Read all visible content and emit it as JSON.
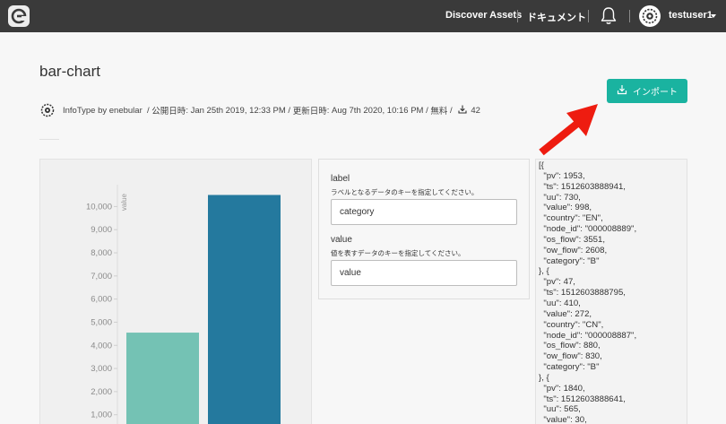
{
  "nav": {
    "discover_label": "Discover Assets",
    "docs_label": "ドキュメント",
    "username": "testuser1"
  },
  "asset": {
    "title": "bar-chart",
    "import_label": "インポート",
    "author": "InfoType by enebular",
    "published_label": "公開日時",
    "published_value": "Jan 25th 2019, 12:33 PM",
    "updated_label": "更新日時",
    "updated_value": "Aug 7th 2020, 10:16 PM",
    "price": "無料",
    "downloads": "42"
  },
  "form": {
    "label_field": {
      "label": "label",
      "help": "ラベルとなるデータのキーを指定してください。",
      "value": "category"
    },
    "value_field": {
      "label": "value",
      "help": "値を表すデータのキーを指定してください。",
      "value": "value"
    }
  },
  "json_text": "[{\n  \"pv\": 1953,\n  \"ts\": 1512603888941,\n  \"uu\": 730,\n  \"value\": 998,\n  \"country\": \"EN\",\n  \"node_id\": \"000008889\",\n  \"os_flow\": 3551,\n  \"ow_flow\": 2608,\n  \"category\": \"B\"\n}, {\n  \"pv\": 47,\n  \"ts\": 1512603888795,\n  \"uu\": 410,\n  \"value\": 272,\n  \"country\": \"CN\",\n  \"node_id\": \"000008887\",\n  \"os_flow\": 880,\n  \"ow_flow\": 830,\n  \"category\": \"B\"\n}, {\n  \"pv\": 1840,\n  \"ts\": 1512603888641,\n  \"uu\": 565,\n  \"value\": 30,",
  "chart_data": {
    "type": "bar",
    "ylabel": "value",
    "yticks": [
      1000,
      2000,
      3000,
      4000,
      5000,
      6000,
      7000,
      8000,
      9000,
      10000
    ],
    "ytick_labels": [
      "1,000",
      "2,000",
      "3,000",
      "4,000",
      "5,000",
      "6,000",
      "7,000",
      "8,000",
      "9,000",
      "10,000"
    ],
    "values": [
      4550,
      10500
    ],
    "colors": [
      "#74c2b4",
      "#24799e"
    ],
    "ylim": [
      0,
      11000
    ]
  },
  "colors": {
    "topbar": "#3a3a3a",
    "accent": "#1ab3a0",
    "arrow": "#ee1c10"
  }
}
